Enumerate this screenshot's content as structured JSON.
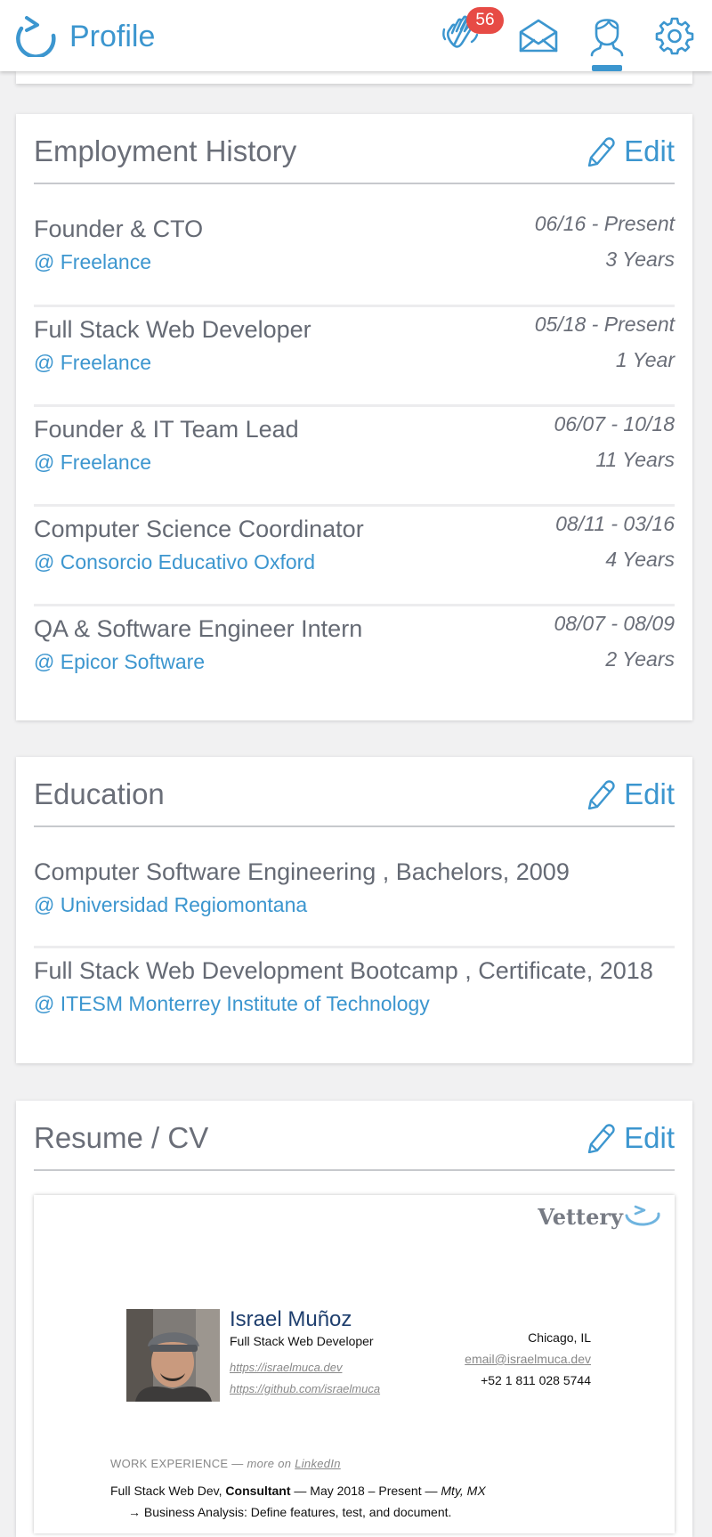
{
  "header": {
    "title": "Profile",
    "notification_count": "56",
    "nav_icons": [
      "waving-hand-icon",
      "envelope-icon",
      "user-icon",
      "gear-icon"
    ],
    "accent_color": "#3c96cf",
    "badge_color": "#e74b45"
  },
  "employment": {
    "title": "Employment History",
    "edit_label": "Edit",
    "items": [
      {
        "title": "Founder & CTO",
        "org": "@ Freelance",
        "dates": "06/16 - Present",
        "duration": "3 Years"
      },
      {
        "title": "Full Stack Web Developer",
        "org": "@ Freelance",
        "dates": "05/18 - Present",
        "duration": "1 Year"
      },
      {
        "title": "Founder & IT Team Lead",
        "org": "@ Freelance",
        "dates": "06/07 - 10/18",
        "duration": "11 Years"
      },
      {
        "title": "Computer Science Coordinator",
        "org": "@ Consorcio Educativo Oxford",
        "dates": "08/11 - 03/16",
        "duration": "4 Years"
      },
      {
        "title": "QA & Software Engineer Intern",
        "org": "@ Epicor Software",
        "dates": "08/07 - 08/09",
        "duration": "2 Years"
      }
    ]
  },
  "education": {
    "title": "Education",
    "edit_label": "Edit",
    "items": [
      {
        "title": "Computer Software Engineering , Bachelors, 2009",
        "org": "@ Universidad Regiomontana"
      },
      {
        "title": "Full Stack Web Development Bootcamp , Certificate, 2018",
        "org": "@ ITESM Monterrey Institute of Technology"
      }
    ]
  },
  "resume": {
    "title": "Resume / CV",
    "edit_label": "Edit",
    "brand": "Vettery",
    "name": "Israel Muñoz",
    "role": "Full Stack Web Developer",
    "link1": "https://israelmuca.dev",
    "link2": "https://github.com/israelmuca",
    "location": "Chicago, IL",
    "email": "email@israelmuca.dev",
    "phone": "+52 1 811 028 5744",
    "section_title": "WORK EXPERIENCE",
    "section_more": "— more on",
    "section_link": "LinkedIn",
    "job_title": "Full Stack Web Dev,",
    "job_role": "Consultant",
    "job_dates": "— May 2018 – Present —",
    "job_location": "Mty, MX",
    "bullet_arrow": "→",
    "bullet": "Business Analysis: Define features, test, and document."
  }
}
